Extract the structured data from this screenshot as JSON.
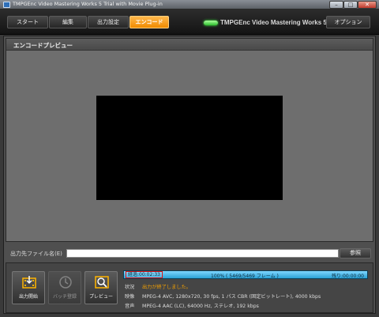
{
  "window": {
    "title": "TMPGEnc Video Mastering Works 5 Trial with Movie Plug-in",
    "minimize_glyph": "–",
    "maximize_glyph": "□",
    "close_glyph": "✕"
  },
  "nav": {
    "tabs": [
      "スタート",
      "編集",
      "出力設定",
      "エンコード"
    ],
    "active_tab": "エンコード",
    "brand": "TMPGEnc Video Mastering Works 5",
    "options_label": "オプション"
  },
  "preview": {
    "header": "エンコードプレビュー"
  },
  "output_file": {
    "label": "出力先ファイル名(E)",
    "value": "",
    "browse_label": "参照"
  },
  "actions": {
    "encode_start_label": "出力開始",
    "batch_register_label": "バッチ登録",
    "preview_label": "プレビュー"
  },
  "progress": {
    "elapsed": "経過:00:02:33",
    "center": "100% ( 5469/5469 フレーム )",
    "remaining": "残り:00:00:00",
    "percent": 100
  },
  "info": {
    "status_key": "状況",
    "status_value": "出力が終了しました。",
    "video_key": "映像",
    "video_value": "MPEG-4 AVC, 1280x720, 30 fps, 1 パス CBR (固定ビットレート), 4000 kbps",
    "audio_key": "音声",
    "audio_value": "MPEG-4 AAC (LC), 64000 Hz, ステレオ, 192 kbps"
  },
  "colors": {
    "accent": "#f08a00",
    "progress": "#2aa2d6",
    "status_text": "#f3a000",
    "elapsed_border": "#e01010"
  },
  "icons": {
    "encode_start": "film-export-icon",
    "batch_register": "clock-icon",
    "preview": "magnifier-film-icon"
  }
}
